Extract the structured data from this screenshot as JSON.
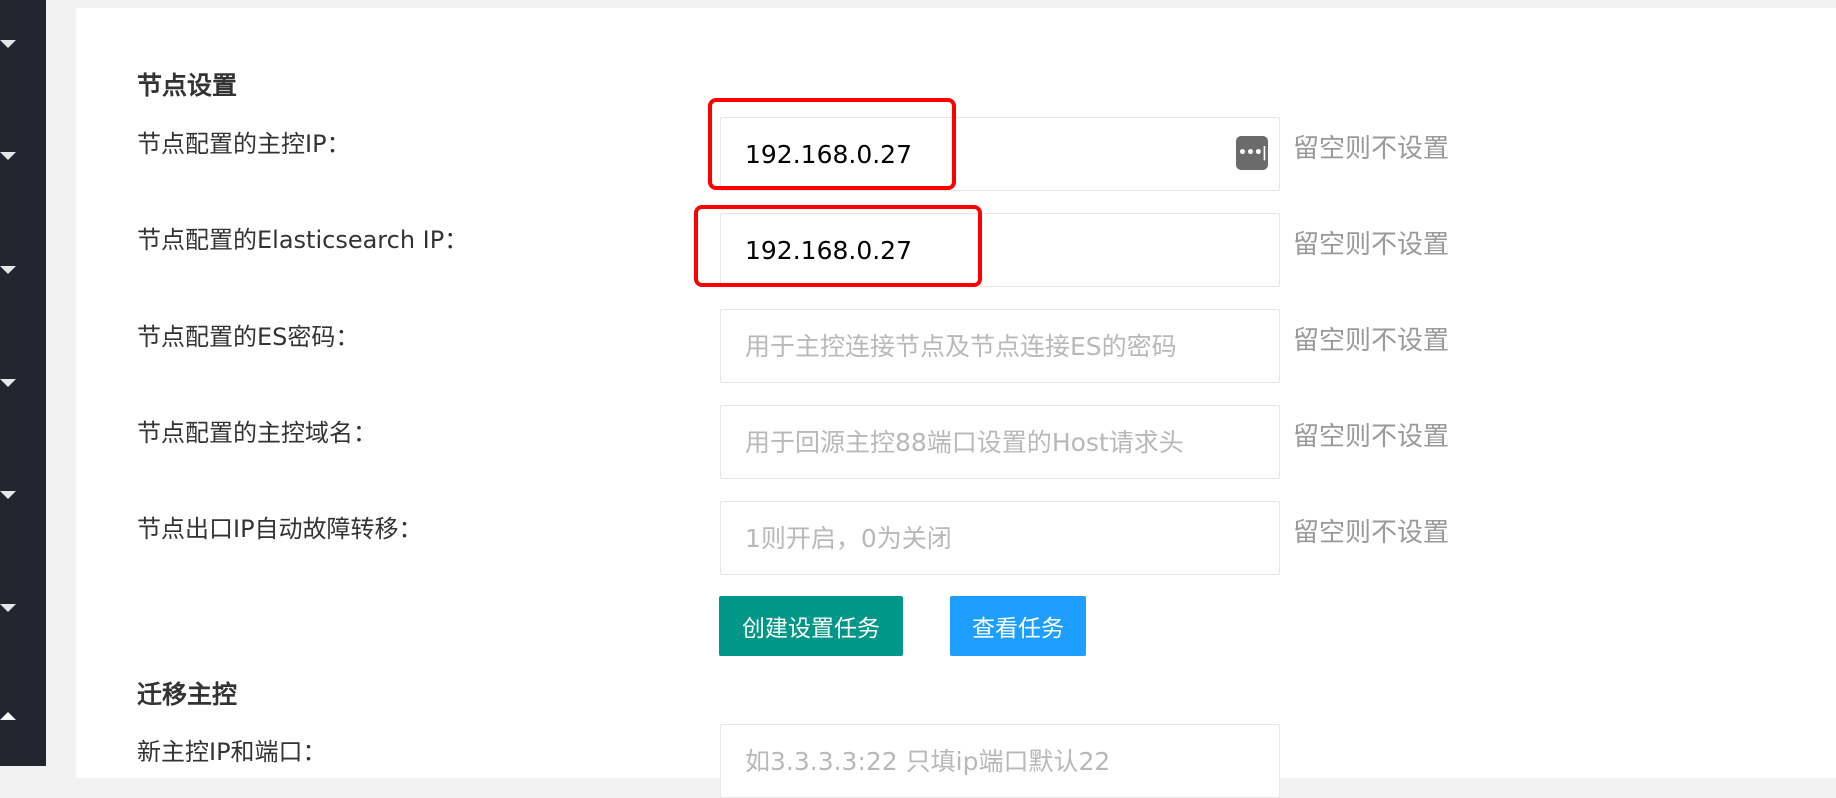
{
  "section_node": {
    "title": "节点设置"
  },
  "rows": [
    {
      "label": "节点配置的主控IP：",
      "value": "192.168.0.27",
      "placeholder": "",
      "hint": "留空则不设置"
    },
    {
      "label": "节点配置的Elasticsearch IP：",
      "value": "192.168.0.27",
      "placeholder": "",
      "hint": "留空则不设置"
    },
    {
      "label": "节点配置的ES密码：",
      "value": "",
      "placeholder": "用于主控连接节点及节点连接ES的密码",
      "hint": "留空则不设置"
    },
    {
      "label": "节点配置的主控域名：",
      "value": "",
      "placeholder": "用于回源主控88端口设置的Host请求头",
      "hint": "留空则不设置"
    },
    {
      "label": "节点出口IP自动故障转移：",
      "value": "",
      "placeholder": "1则开启，0为关闭",
      "hint": "留空则不设置"
    }
  ],
  "buttons": {
    "create_task": "创建设置任务",
    "view_task": "查看任务"
  },
  "section_migrate": {
    "title": "迁移主控",
    "new_master_label": "新主控IP和端口：",
    "new_master_placeholder": "如3.3.3.3:22 只填ip端口默认22"
  },
  "icons": {
    "password_manager": "password-dots-icon"
  },
  "colors": {
    "sidebar": "#23262e",
    "primary_button": "#009688",
    "secondary_button": "#1e9fff",
    "highlight": "#ff0000"
  }
}
